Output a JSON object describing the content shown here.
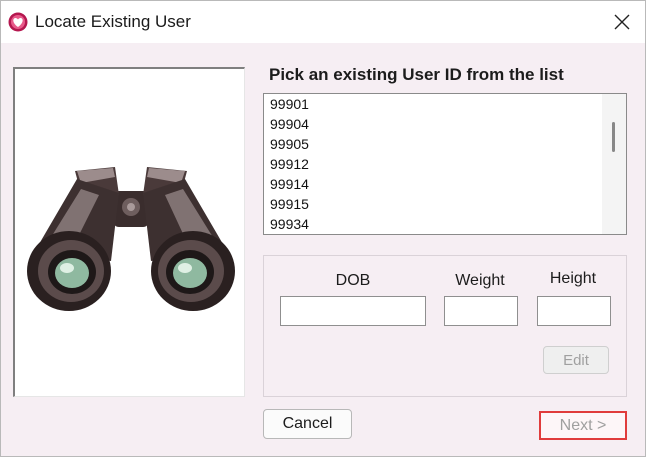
{
  "window": {
    "title": "Locate Existing User",
    "app_icon": "heart-app-icon",
    "close_icon": "close-icon"
  },
  "image_panel": {
    "icon": "binoculars-icon"
  },
  "user_list": {
    "heading": "Pick an existing User ID from the list",
    "items": [
      "99901",
      "99904",
      "99905",
      "99912",
      "99914",
      "99915",
      "99934"
    ]
  },
  "details": {
    "dob_label": "DOB",
    "weight_label": "Weight",
    "height_label": "Height",
    "dob_value": "",
    "weight_value": "",
    "height_value": "",
    "edit_label": "Edit"
  },
  "footer": {
    "cancel_label": "Cancel",
    "next_label": "Next >"
  },
  "colors": {
    "dialog_background": "#f6eef3",
    "disabled_text": "#a0a0a0",
    "next_focus_border": "#e03c3c",
    "app_icon": "#b5174f"
  }
}
